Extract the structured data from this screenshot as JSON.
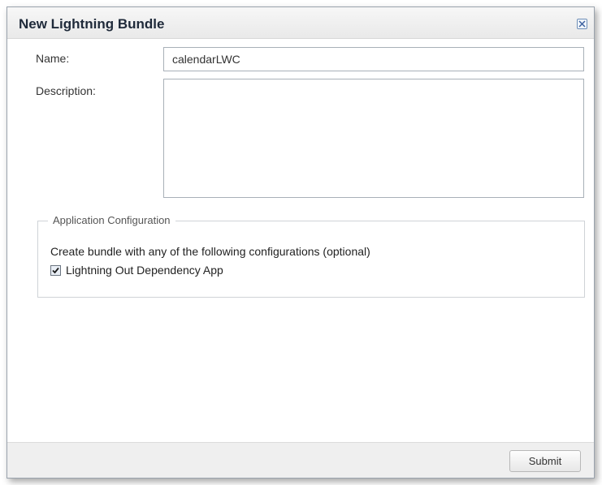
{
  "dialog": {
    "title": "New Lightning Bundle",
    "close_icon": "close-icon"
  },
  "form": {
    "name_label": "Name:",
    "name_value": "calendarLWC",
    "description_label": "Description:",
    "description_value": ""
  },
  "app_config": {
    "legend": "Application Configuration",
    "instructions": "Create bundle with any of the following configurations (optional)",
    "checkbox_label": "Lightning Out Dependency App",
    "checkbox_checked": true
  },
  "footer": {
    "submit_label": "Submit"
  },
  "colors": {
    "title": "#1f2a3a",
    "close_border": "#6f8fb7"
  }
}
